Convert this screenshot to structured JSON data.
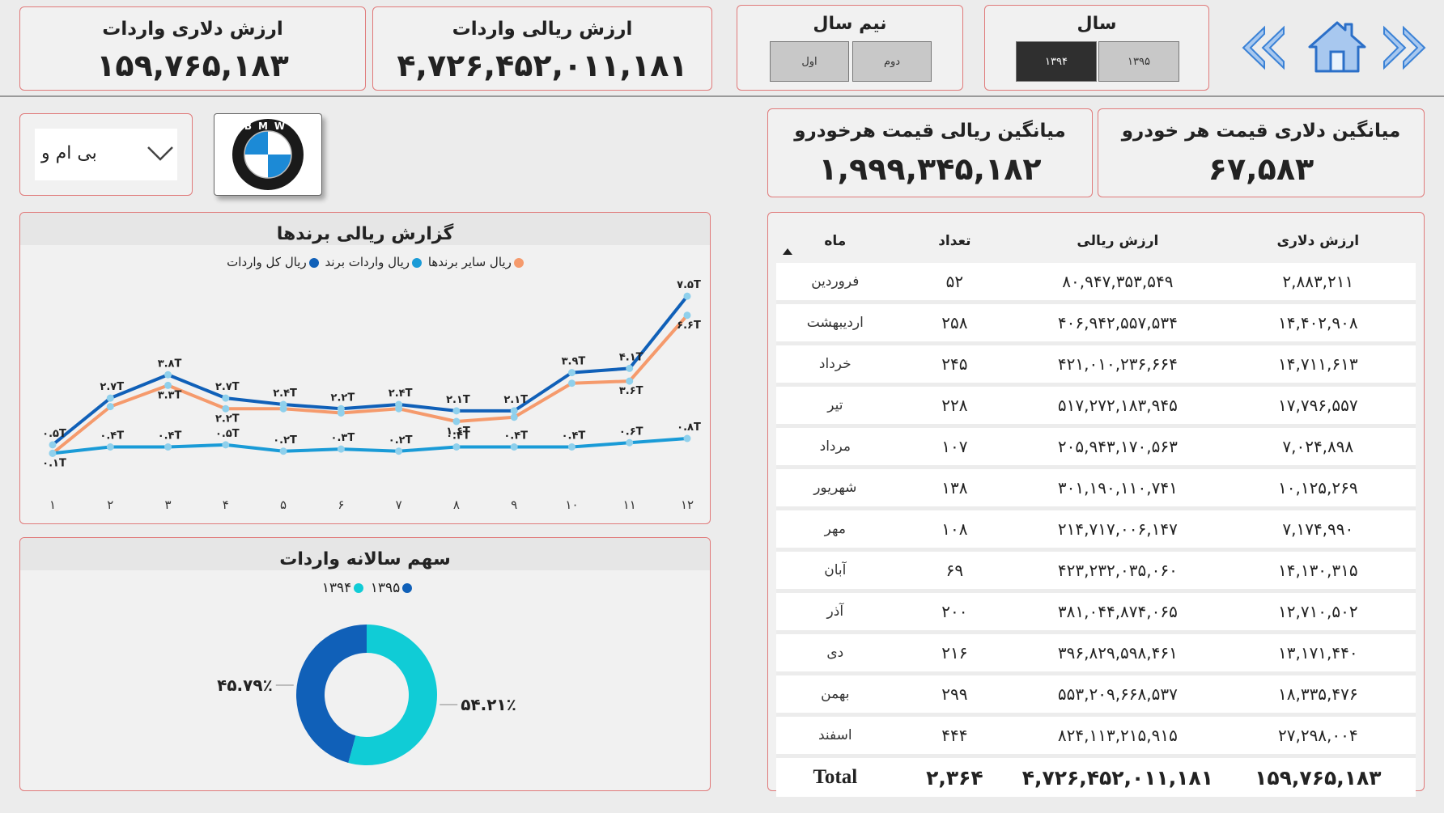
{
  "kpis": {
    "dollar_import": {
      "title": "ارزش دلاری واردات",
      "value": "۱۵۹,۷۶۵,۱۸۳"
    },
    "rial_import": {
      "title": "ارزش ریالی واردات",
      "value": "۴,۷۲۶,۴۵۲,۰۱۱,۱۸۱"
    },
    "avg_rial": {
      "title": "میانگین ریالی قیمت هرخودرو",
      "value": "۱,۹۹۹,۳۴۵,۱۸۲"
    },
    "avg_dollar": {
      "title": "میانگین دلاری قیمت هر خودرو",
      "value": "۶۷,۵۸۳"
    }
  },
  "half_year": {
    "title": "نیم سال",
    "options": [
      "اول",
      "دوم"
    ]
  },
  "year": {
    "title": "سال",
    "options": [
      "۱۳۹۴",
      "۱۳۹۵"
    ],
    "selected": "۱۳۹۴"
  },
  "brand_select": {
    "value": "بی ام و",
    "logo_text": "BMW"
  },
  "line_chart": {
    "title": "گزارش ریالی برندها"
  },
  "donut_chart": {
    "title": "سهم سالانه واردات"
  },
  "colors": {
    "dark_blue": "#1060b8",
    "mid_blue": "#1a9bd7",
    "orange": "#f59a6c",
    "cyan": "#10ccd6",
    "card_border": "#e07a7a"
  },
  "chart_data": [
    {
      "type": "line",
      "title": "گزارش ریالی برندها",
      "categories": [
        "۱",
        "۲",
        "۳",
        "۴",
        "۵",
        "۶",
        "۷",
        "۸",
        "۹",
        "۱۰",
        "۱۱",
        "۱۲"
      ],
      "unit": "T",
      "legend_position": "top",
      "series": [
        {
          "name": "ریال کل واردات",
          "color": "#1060b8",
          "values": [
            0.5,
            2.7,
            3.8,
            2.7,
            2.4,
            2.2,
            2.4,
            2.1,
            2.1,
            3.9,
            4.1,
            7.5
          ],
          "labels": [
            "۰.۵T",
            "۲.۷T",
            "۳.۸T",
            "۲.۷T",
            "۲.۴T",
            "۲.۲T",
            "۲.۴T",
            "۲.۱T",
            "۲.۱T",
            "۳.۹T",
            "۴.۱T",
            "۷.۵T"
          ]
        },
        {
          "name": "ریال سایر برندها",
          "color": "#f59a6c",
          "values": [
            0.1,
            2.3,
            3.3,
            2.2,
            2.2,
            2.0,
            2.2,
            1.6,
            1.8,
            3.4,
            3.5,
            6.6
          ],
          "labels": [
            "۰.۱T",
            "",
            "۳.۳T",
            "۲.۲T",
            "",
            "",
            "",
            "۱.۶T",
            "",
            "",
            "۳.۶T",
            "۶.۶T"
          ]
        },
        {
          "name": "ریال واردات برند",
          "color": "#1a9bd7",
          "values": [
            0.1,
            0.4,
            0.4,
            0.5,
            0.2,
            0.3,
            0.2,
            0.4,
            0.4,
            0.4,
            0.6,
            0.8
          ],
          "labels": [
            "",
            "۰.۴T",
            "۰.۴T",
            "۰.۵T",
            "۰.۲T",
            "۰.۳T",
            "۰.۲T",
            "۰.۴T",
            "۰.۴T",
            "۰.۴T",
            "۰.۶T",
            "۰.۸T"
          ]
        }
      ]
    },
    {
      "type": "pie",
      "title": "سهم سالانه واردات",
      "categories": [
        "۱۳۹۴",
        "۱۳۹۵"
      ],
      "values": [
        54.21,
        45.79
      ],
      "labels": [
        "۵۴.۲۱٪",
        "۴۵.۷۹٪"
      ],
      "colors": [
        "#10ccd6",
        "#1060b8"
      ],
      "legend_position": "top"
    }
  ],
  "table": {
    "columns": [
      "ماه",
      "تعداد",
      "ارزش ریالی",
      "ارزش دلاری"
    ],
    "rows": [
      {
        "month": "فروردین",
        "count": "۵۲",
        "rial": "۸۰,۹۴۷,۳۵۳,۵۴۹",
        "dollar": "۲,۸۸۳,۲۱۱"
      },
      {
        "month": "اردیبهشت",
        "count": "۲۵۸",
        "rial": "۴۰۶,۹۴۲,۵۵۷,۵۳۴",
        "dollar": "۱۴,۴۰۲,۹۰۸"
      },
      {
        "month": "خرداد",
        "count": "۲۴۵",
        "rial": "۴۲۱,۰۱۰,۲۳۶,۶۶۴",
        "dollar": "۱۴,۷۱۱,۶۱۳"
      },
      {
        "month": "تیر",
        "count": "۲۲۸",
        "rial": "۵۱۷,۲۷۲,۱۸۳,۹۴۵",
        "dollar": "۱۷,۷۹۶,۵۵۷"
      },
      {
        "month": "مرداد",
        "count": "۱۰۷",
        "rial": "۲۰۵,۹۴۳,۱۷۰,۵۶۳",
        "dollar": "۷,۰۲۴,۸۹۸"
      },
      {
        "month": "شهریور",
        "count": "۱۳۸",
        "rial": "۳۰۱,۱۹۰,۱۱۰,۷۴۱",
        "dollar": "۱۰,۱۲۵,۲۶۹"
      },
      {
        "month": "مهر",
        "count": "۱۰۸",
        "rial": "۲۱۴,۷۱۷,۰۰۶,۱۴۷",
        "dollar": "۷,۱۷۴,۹۹۰"
      },
      {
        "month": "آبان",
        "count": "۶۹",
        "rial": "۴۲۳,۲۳۲,۰۳۵,۰۶۰",
        "dollar": "۱۴,۱۳۰,۳۱۵"
      },
      {
        "month": "آذر",
        "count": "۲۰۰",
        "rial": "۳۸۱,۰۴۴,۸۷۴,۰۶۵",
        "dollar": "۱۲,۷۱۰,۵۰۲"
      },
      {
        "month": "دی",
        "count": "۲۱۶",
        "rial": "۳۹۶,۸۲۹,۵۹۸,۴۶۱",
        "dollar": "۱۳,۱۷۱,۴۴۰"
      },
      {
        "month": "بهمن",
        "count": "۲۹۹",
        "rial": "۵۵۳,۲۰۹,۶۶۸,۵۳۷",
        "dollar": "۱۸,۳۳۵,۴۷۶"
      },
      {
        "month": "اسفند",
        "count": "۴۴۴",
        "rial": "۸۲۴,۱۱۳,۲۱۵,۹۱۵",
        "dollar": "۲۷,۲۹۸,۰۰۴"
      }
    ],
    "total": {
      "label": "Total",
      "count": "۲,۳۶۴",
      "rial": "۴,۷۲۶,۴۵۲,۰۱۱,۱۸۱",
      "dollar": "۱۵۹,۷۶۵,۱۸۳"
    }
  }
}
